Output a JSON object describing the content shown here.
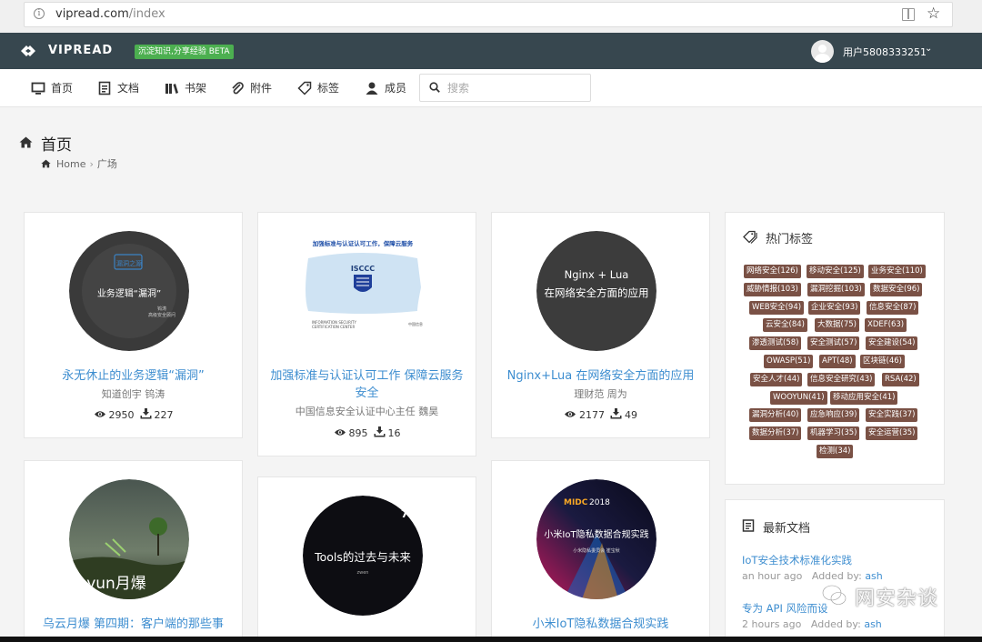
{
  "browser": {
    "url_host": "vipread.com",
    "url_path": "/index"
  },
  "header": {
    "brand": "VIPREAD",
    "badge": "沉淀知识,分享经验 BETA",
    "user": "用户5808333251"
  },
  "nav": {
    "items": [
      {
        "label": "首页",
        "icon": "monitor-icon"
      },
      {
        "label": "文档",
        "icon": "document-icon"
      },
      {
        "label": "书架",
        "icon": "bookshelf-icon"
      },
      {
        "label": "附件",
        "icon": "paperclip-icon"
      },
      {
        "label": "标签",
        "icon": "tag-icon"
      },
      {
        "label": "成员",
        "icon": "members-icon"
      }
    ],
    "search_placeholder": "搜索"
  },
  "page": {
    "title": "首页",
    "breadcrumb_home": "Home",
    "breadcrumb_current": "广场"
  },
  "cards": [
    {
      "title": "永无休止的业务逻辑“漏洞”",
      "author": "知道创宇 钨涛",
      "views": "2950",
      "downloads": "227",
      "img_text": "业务逻辑“漏洞”"
    },
    {
      "title": "加强标准与认证认可工作 保障云服务安全",
      "author": "中国信息安全认证中心主任 魏昊",
      "views": "895",
      "downloads": "16",
      "img_text": "ISCCC"
    },
    {
      "title": "Nginx+Lua 在网络安全方面的应用",
      "author": "理财范 周为",
      "views": "2177",
      "downloads": "49",
      "img_text": "Nginx + Lua\n在网络安全方面的应用"
    },
    {
      "title": "乌云月爆 第四期：客户端的那些事",
      "img_text": "yun月爆"
    },
    {
      "title": "Tools的过去与未来",
      "img_text": "Tools的过去与未来"
    },
    {
      "title": "小米IoT隐私数据合规实践",
      "img_text": "小米IoT隐私数据合规实践"
    }
  ],
  "hot_tags": {
    "title": "热门标签",
    "tags": [
      "网络安全(126)",
      "移动安全(125)",
      "业务安全(110)",
      "威胁情报(103)",
      "漏洞挖掘(103)",
      "数据安全(96)",
      "WEB安全(94)",
      "企业安全(93)",
      "信息安全(87)",
      "云安全(84)",
      "大数据(75)",
      "XDEF(63)",
      "渗透测试(58)",
      "安全测试(57)",
      "安全建设(54)",
      "OWASP(51)",
      "APT(48)",
      "区块链(46)",
      "安全人才(44)",
      "信息安全研究(43)",
      "RSA(42)",
      "WOOYUN(41)",
      "移动应用安全(41)",
      "漏洞分析(40)",
      "应急响应(39)",
      "安全实践(37)",
      "数据分析(37)",
      "机器学习(35)",
      "安全运营(35)",
      "检测(34)"
    ]
  },
  "latest_docs": {
    "title": "最新文档",
    "items": [
      {
        "title": "IoT安全技术标准化实践",
        "time": "an hour ago",
        "added_by_label": "Added by:",
        "who": "ash"
      },
      {
        "title": "专为 API 风险而设",
        "time": "2 hours ago",
        "added_by_label": "Added by:",
        "who": "ash"
      }
    ]
  },
  "watermark": "网安杂谈",
  "colors": {
    "header_bg": "#37474f",
    "link": "#3e8ed0",
    "tag_bg": "#7a5145",
    "badge": "#4caf50"
  }
}
